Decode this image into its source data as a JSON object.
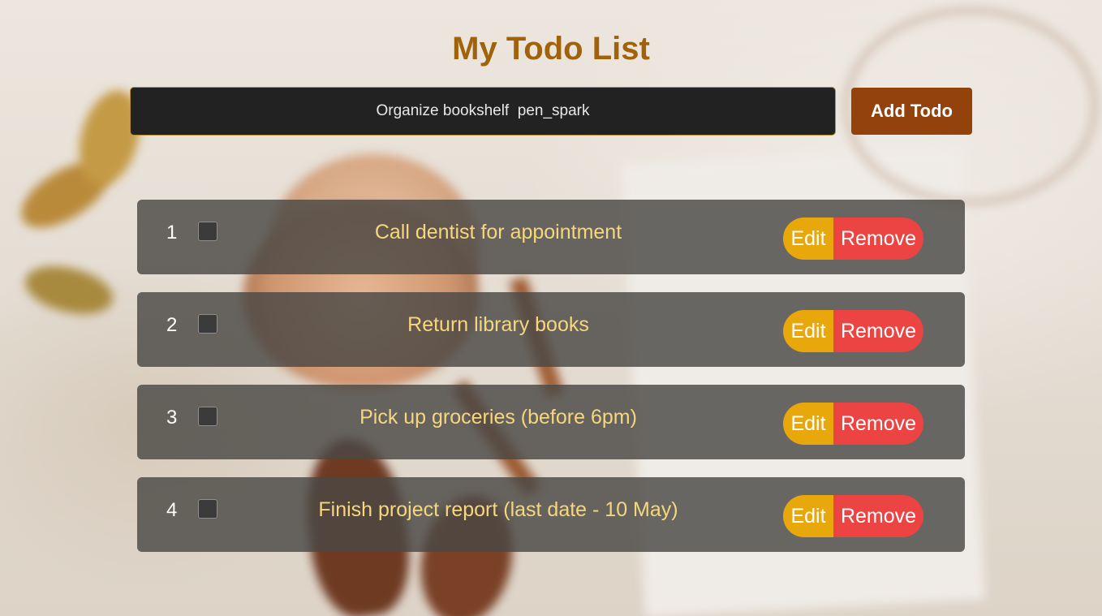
{
  "header": {
    "title": "My Todo List"
  },
  "input": {
    "value": "Organize bookshelf  pen_spark",
    "placeholder": ""
  },
  "toolbar": {
    "add_label": "Add Todo"
  },
  "buttons": {
    "edit_label": "Edit",
    "remove_label": "Remove"
  },
  "todos": [
    {
      "number": "1",
      "text": "Call dentist for appointment",
      "done": false
    },
    {
      "number": "2",
      "text": "Return library books",
      "done": false
    },
    {
      "number": "3",
      "text": "Pick up groceries (before 6pm)",
      "done": false
    },
    {
      "number": "4",
      "text": "Finish project report (last date - 10 May)",
      "done": false
    }
  ],
  "colors": {
    "title": "#a0620a",
    "add_button": "#94420c",
    "edit_button": "#e8a80b",
    "remove_button": "#ec4343",
    "todo_text": "#f5d77e"
  }
}
